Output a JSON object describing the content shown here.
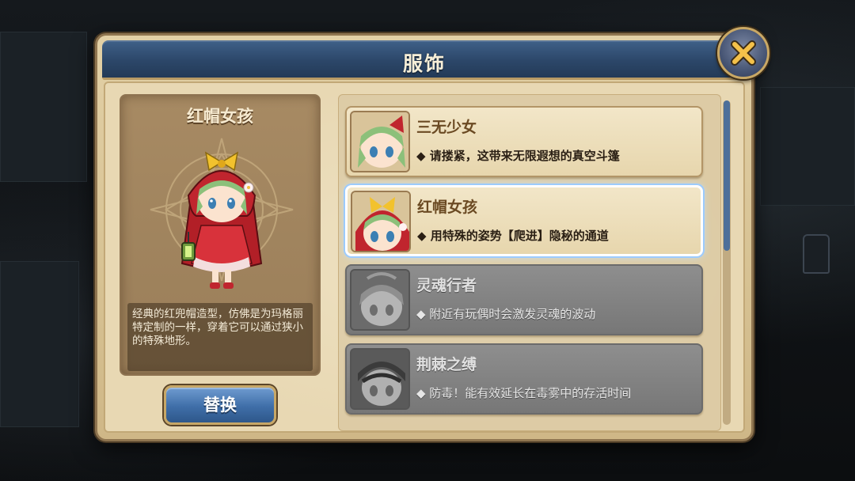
{
  "dialog": {
    "title": "服饰",
    "close_icon": "close-x-icon"
  },
  "preview": {
    "name": "红帽女孩",
    "description": "经典的红兜帽造型，仿佛是为玛格丽特定制的一样，穿着它可以通过狭小的特殊地形。",
    "character_icon": "red-hood-girl-figure"
  },
  "actions": {
    "replace_label": "替换"
  },
  "outfits": [
    {
      "name": "三无少女",
      "desc": "◆ 请搂紧，这带来无限遐想的真空斗篷",
      "state": "owned"
    },
    {
      "name": "红帽女孩",
      "desc": "◆ 用特殊的姿势【爬进】隐秘的通道",
      "state": "selected"
    },
    {
      "name": "灵魂行者",
      "desc": "◆ 附近有玩偶时会激发灵魂的波动",
      "state": "locked"
    },
    {
      "name": "荆棘之缚",
      "desc": "◆ 防毒！能有效延长在毒雾中的存活时间",
      "state": "locked"
    }
  ],
  "colors": {
    "header_blue": "#2c4769",
    "parchment": "#e2d0a6",
    "selected_glow": "#bfe1ff",
    "locked_gray": "#808080"
  }
}
